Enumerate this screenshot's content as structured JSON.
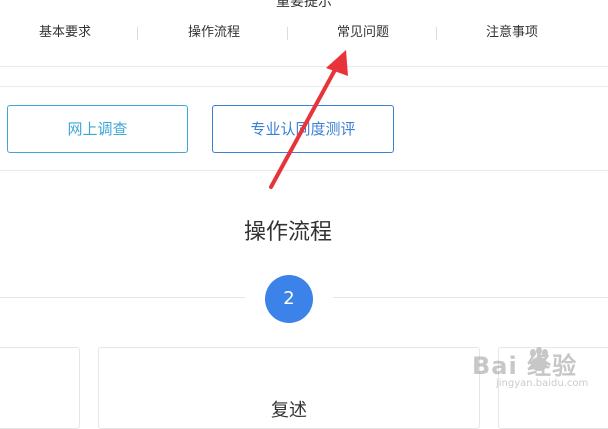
{
  "header": {
    "title": "重要提示"
  },
  "tabs": [
    {
      "label": "基本要求"
    },
    {
      "label": "操作流程"
    },
    {
      "label": "常见问题"
    },
    {
      "label": "注意事项"
    }
  ],
  "buttons": {
    "survey_label": "网上调查",
    "evaluation_label": "专业认同度测评"
  },
  "section": {
    "title": "操作流程",
    "step_number": "2"
  },
  "cards": [
    {
      "label": ""
    },
    {
      "label": "复述"
    },
    {
      "label": ""
    }
  ],
  "watermark": {
    "text": "Bai 经验",
    "url": "jingyan.baidu.com"
  },
  "colors": {
    "accent_blue": "#3b83e8",
    "survey_border": "#3fa7d6",
    "evaluation_border": "#3b7fd6",
    "arrow_red": "#e8333a"
  }
}
